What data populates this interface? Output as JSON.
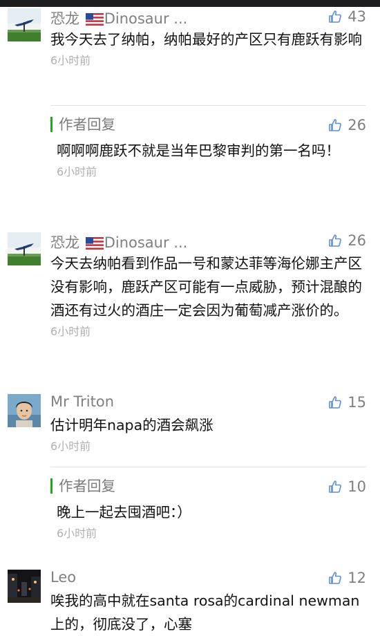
{
  "accent_color": "#1aad19",
  "like_icon": "thumbs-up-icon",
  "comments": [
    {
      "author": "恐龙",
      "flag": "us-flag-icon",
      "author_suffix": "Dinosaur ...",
      "likes": "43",
      "text": "我今天去了纳帕，纳帕最好的产区只有鹿跃有影响",
      "time": "6小时前",
      "reply": {
        "label": "作者回复",
        "likes": "26",
        "text": "啊啊啊鹿跃不就是当年巴黎审判的第一名吗！",
        "time": "6小时前"
      }
    },
    {
      "author": "恐龙",
      "flag": "us-flag-icon",
      "author_suffix": "Dinosaur ...",
      "likes": "26",
      "text": "今天去纳帕看到作品一号和蒙达菲等海伦娜主产区没有影响，鹿跃产区可能有一点威胁，预计混酿的酒还有过火的酒庄一定会因为葡萄减产涨价的。",
      "time": "6小时前"
    },
    {
      "author": "Mr Triton",
      "likes": "15",
      "text": "估计明年napa的酒会飙涨",
      "time": "6小时前",
      "reply": {
        "label": "作者回复",
        "likes": "10",
        "text": "晚上一起去囤酒吧：）",
        "time": "6小时前"
      }
    },
    {
      "author": "Leo",
      "likes": "12",
      "text": "唉我的高中就在santa rosa的cardinal newman上的，彻底没了，心塞",
      "time": ""
    }
  ]
}
